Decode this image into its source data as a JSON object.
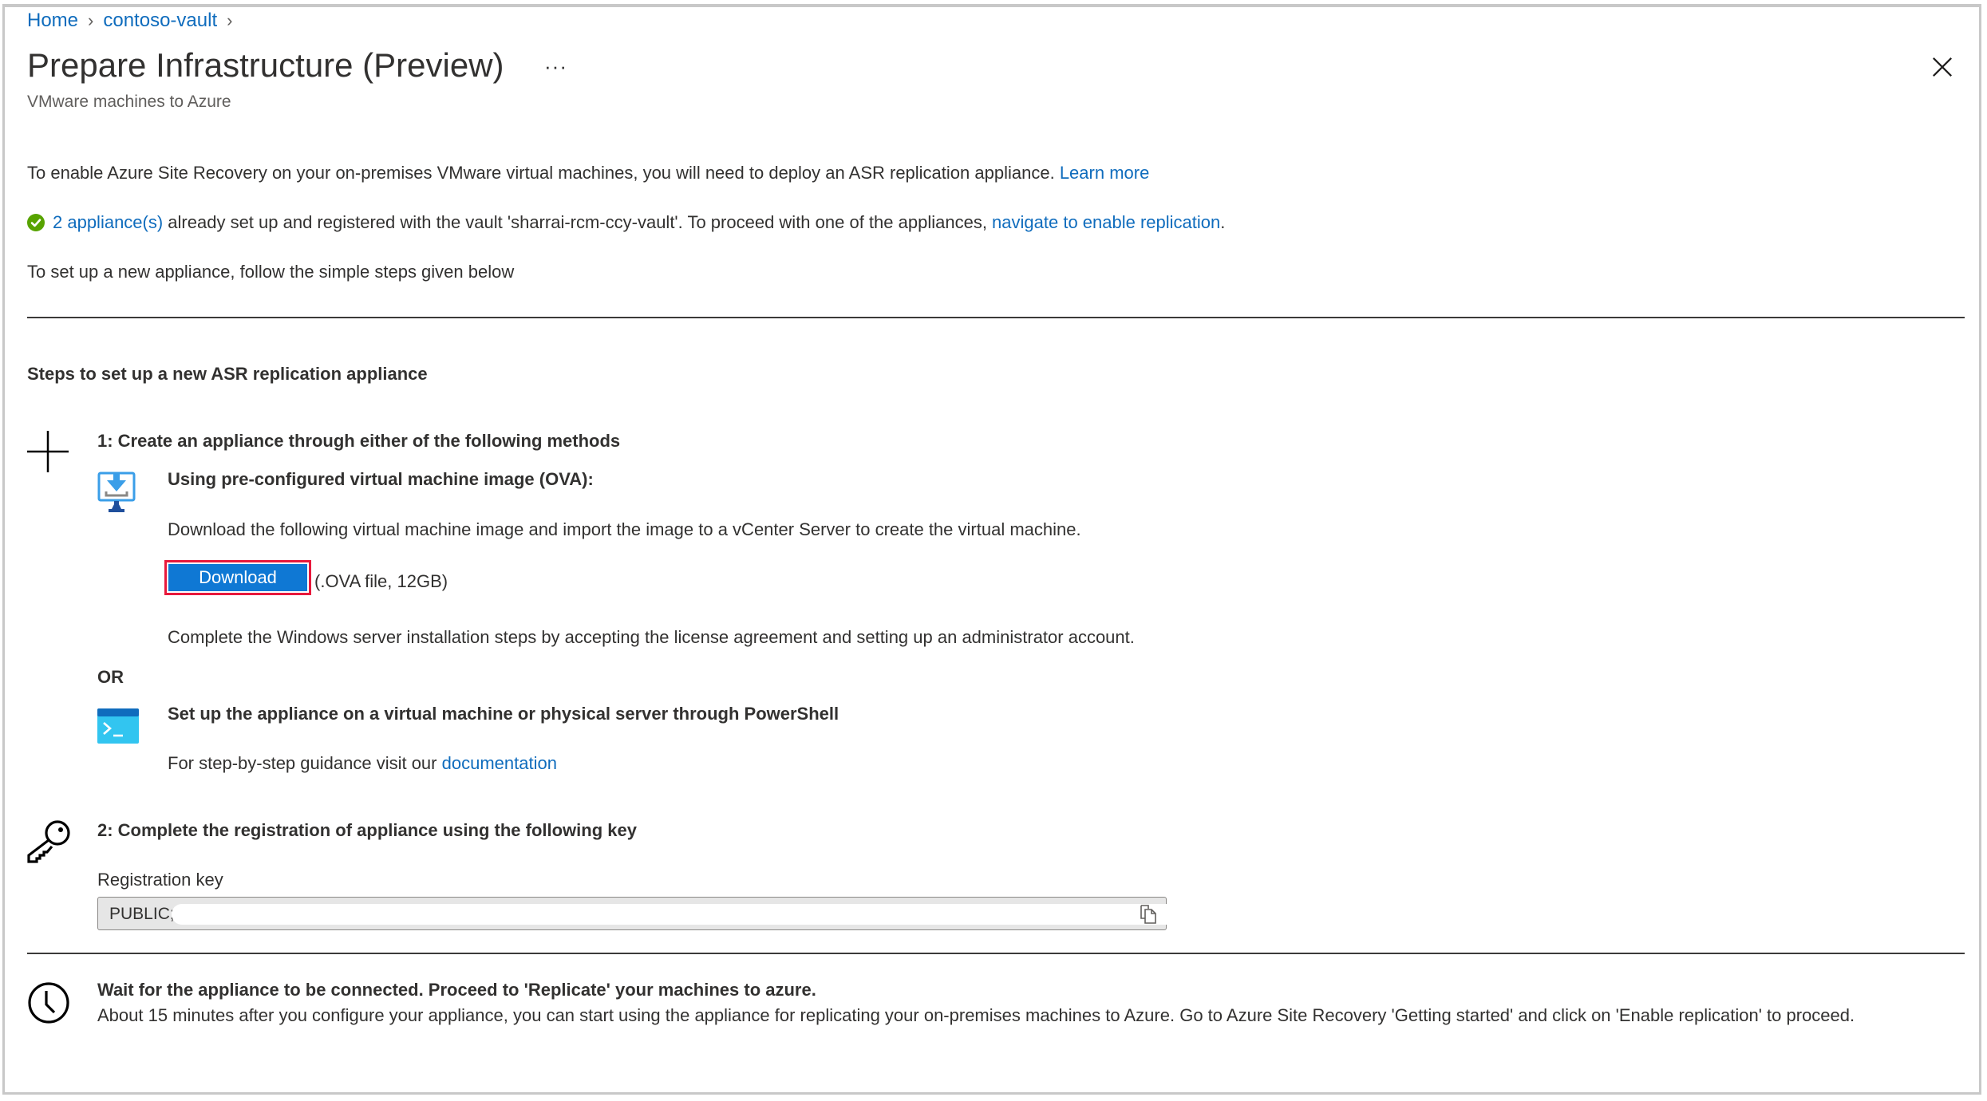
{
  "breadcrumb": [
    {
      "label": "Home"
    },
    {
      "label": "contoso-vault"
    }
  ],
  "header": {
    "title": "Prepare Infrastructure (Preview)",
    "more_label": "···",
    "subtitle": "VMware machines to Azure",
    "close_icon": "close-icon"
  },
  "intro": {
    "text": "To enable Azure Site Recovery on your on-premises VMware virtual machines, you will need to deploy an ASR replication appliance.",
    "learn_more": "Learn more"
  },
  "status": {
    "icon": "check-circle-icon",
    "color": "#57a300",
    "link_count": "2 appliance(s)",
    "text": " already set up and registered with the vault 'sharrai-rcm-ccy-vault'. To proceed with one of the appliances, ",
    "link_action": "navigate to enable replication",
    "suffix": "."
  },
  "setup_hint": "To set up a new appliance, follow the simple steps given below",
  "steps": {
    "heading": "Steps to set up a new ASR replication appliance",
    "step1": {
      "icon": "plus-icon",
      "title": "1: Create an appliance through either of the following methods",
      "ova": {
        "icon": "monitor-download-icon",
        "title": "Using pre-configured virtual machine image (OVA):",
        "description": "Download the following virtual machine image and import the image to a vCenter Server to create the virtual machine.",
        "download_label": "Download",
        "file_info": "(.OVA file, 12GB)",
        "post_text": "Complete the Windows server installation steps by accepting the license agreement and setting up an administrator account."
      },
      "or_label": "OR",
      "powershell": {
        "icon": "terminal-icon",
        "title": "Set up the appliance on a virtual machine or physical server through PowerShell",
        "guidance": "For step-by-step guidance visit our ",
        "doc_link": "documentation"
      }
    },
    "step2": {
      "icon": "key-icon",
      "title": "2: Complete the registration of appliance using the following key",
      "key_label": "Registration key",
      "key_value": "PUBLIC;",
      "copy_icon": "copy-icon"
    },
    "step3": {
      "icon": "clock-icon",
      "title": "Wait for the appliance to be connected. Proceed to 'Replicate' your machines to azure.",
      "description": "About 15 minutes after you configure your appliance, you can start using the appliance for replicating your on-premises machines to Azure. Go to Azure Site Recovery 'Getting started' and click on 'Enable replication' to proceed."
    }
  },
  "colors": {
    "link": "#0f6cbd",
    "primary_button": "#0f78d4",
    "highlight_border": "#e8193c"
  }
}
